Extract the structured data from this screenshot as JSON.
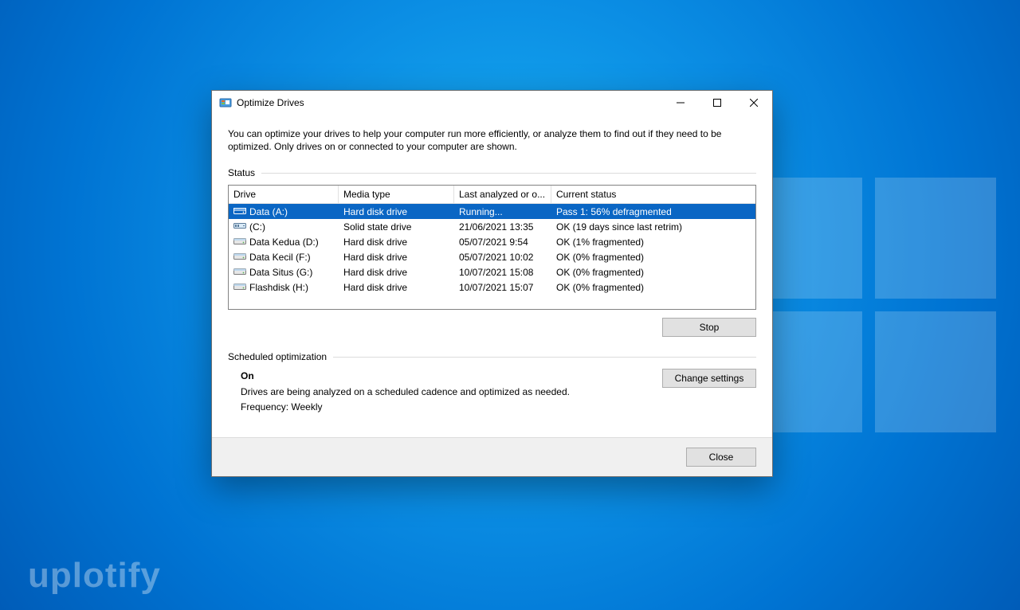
{
  "window": {
    "title": "Optimize Drives",
    "intro": "You can optimize your drives to help your computer run more efficiently, or analyze them to find out if they need to be optimized. Only drives on or connected to your computer are shown."
  },
  "status": {
    "section_label": "Status",
    "columns": {
      "drive": "Drive",
      "media": "Media type",
      "last": "Last analyzed or o...",
      "status": "Current status"
    },
    "rows": [
      {
        "name": "Data (A:)",
        "media": "Hard disk drive",
        "last": "Running...",
        "status": "Pass 1: 56% defragmented",
        "selected": true,
        "icon": "hdd"
      },
      {
        "name": "(C:)",
        "media": "Solid state drive",
        "last": "21/06/2021 13:35",
        "status": "OK (19 days since last retrim)",
        "selected": false,
        "icon": "ssd"
      },
      {
        "name": "Data Kedua (D:)",
        "media": "Hard disk drive",
        "last": "05/07/2021 9:54",
        "status": "OK (1% fragmented)",
        "selected": false,
        "icon": "hdd"
      },
      {
        "name": "Data Kecil (F:)",
        "media": "Hard disk drive",
        "last": "05/07/2021 10:02",
        "status": "OK (0% fragmented)",
        "selected": false,
        "icon": "hdd"
      },
      {
        "name": "Data Situs (G:)",
        "media": "Hard disk drive",
        "last": "10/07/2021 15:08",
        "status": "OK (0% fragmented)",
        "selected": false,
        "icon": "hdd"
      },
      {
        "name": "Flashdisk (H:)",
        "media": "Hard disk drive",
        "last": "10/07/2021 15:07",
        "status": "OK (0% fragmented)",
        "selected": false,
        "icon": "hdd"
      }
    ]
  },
  "buttons": {
    "stop": "Stop",
    "change_settings": "Change settings",
    "close": "Close"
  },
  "scheduled": {
    "section_label": "Scheduled optimization",
    "on_label": "On",
    "desc": "Drives are being analyzed on a scheduled cadence and optimized as needed.",
    "freq": "Frequency: Weekly"
  },
  "watermark": "uplotify"
}
